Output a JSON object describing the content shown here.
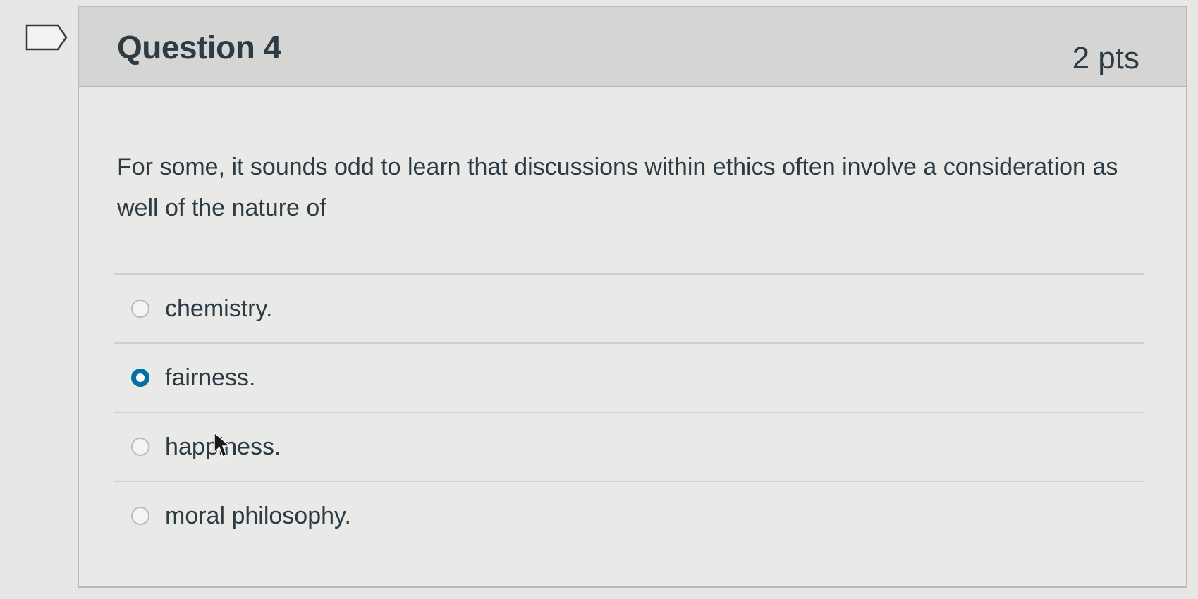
{
  "question": {
    "title": "Question 4",
    "points": "2 pts",
    "text": "For some, it sounds odd to learn that discussions within ethics often involve a consideration as well of the nature of"
  },
  "flag": {
    "icon": "flag-outline-icon"
  },
  "answers": [
    {
      "label": "chemistry.",
      "selected": false
    },
    {
      "label": "fairness.",
      "selected": true
    },
    {
      "label": "happiness.",
      "selected": false
    },
    {
      "label": "moral philosophy.",
      "selected": false
    }
  ],
  "colors": {
    "selected_radio": "#0770a3",
    "text": "#2d3b45",
    "header_bg": "#d5d5d3"
  }
}
